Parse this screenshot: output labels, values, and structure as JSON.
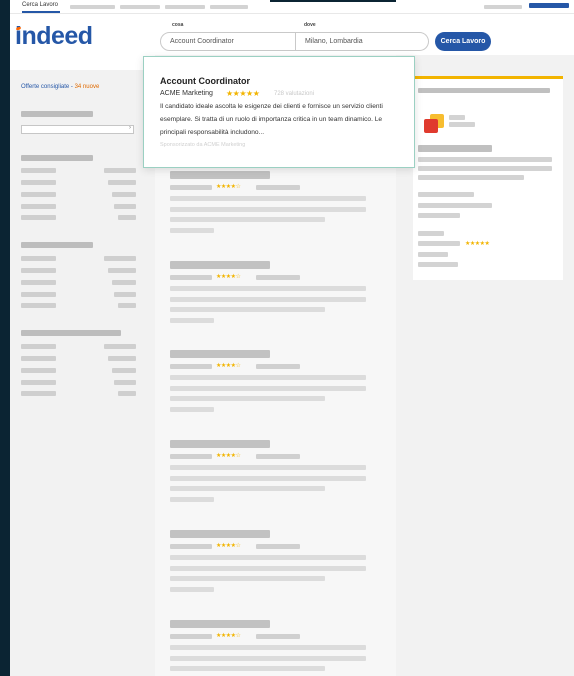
{
  "nav": {
    "active_tab": "Cerca Lavoro"
  },
  "brand": {
    "logo_text": "indeed",
    "color": "#2557a7",
    "accent": "#ff6600"
  },
  "search": {
    "what_label": "cosa",
    "what_value": "Account Coordinator",
    "where_label": "dove",
    "where_value": "Milano, Lombardia",
    "button_label": "Cerca Lavoro"
  },
  "sidebar": {
    "recommended_label": "Offerte consigliate",
    "recommended_sep": " - ",
    "recommended_count": "34 nuove"
  },
  "popup": {
    "title": "Account Coordinator",
    "company": "ACME Marketing",
    "rating": 5,
    "stars": "★★★★★",
    "reviews": "728 valutazioni",
    "description": "Il candidato ideale ascolta le esigenze dei clienti e fornisce un servizio clienti esemplare. Si tratta di un ruolo di importanza critica in un team dinamico. Le principali responsabilità includono...",
    "sponsored": "Sponsorizzato da ACME Marketing"
  },
  "list": {
    "card_stars": "★★★★☆"
  },
  "right_panel": {
    "stars": "★★★★★"
  },
  "colors": {
    "star": "#f2b400",
    "highlight_border": "#9bd0c2",
    "panel_accent": "#f2b400"
  }
}
